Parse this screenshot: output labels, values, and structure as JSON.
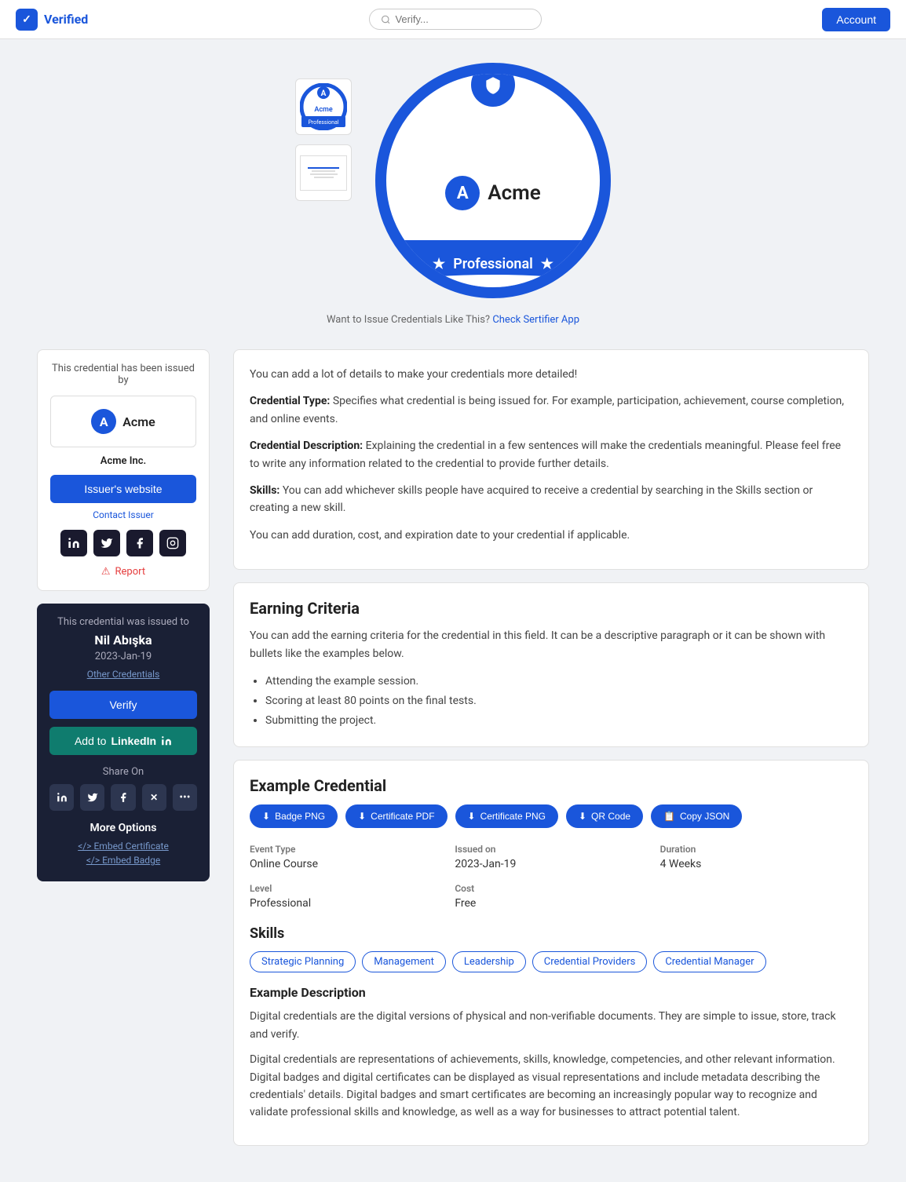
{
  "header": {
    "logo_text": "Verified",
    "search_placeholder": "Verify...",
    "account_btn": "Account"
  },
  "badge": {
    "company_letter": "A",
    "company_name": "Acme",
    "level": "Professional"
  },
  "want_to_issue": {
    "text": "Want to Issue Credentials Like This?",
    "link_text": "Check Sertifier App"
  },
  "sidebar": {
    "issued_by_title": "This credential has been issued by",
    "issuer_letter": "A",
    "issuer_name": "Acme",
    "issuer_company": "Acme Inc.",
    "issuer_website_btn": "Issuer's website",
    "contact_issuer": "Contact Issuer",
    "report_text": "Report",
    "issued_to_title": "This credential was issued to",
    "recipient_name": "Nil Abışka",
    "issue_date": "2023-Jan-19",
    "other_credentials": "Other Credentials",
    "verify_btn": "Verify",
    "linkedin_btn_text": "Add to",
    "linkedin_word": "LinkedIn",
    "share_on": "Share On",
    "more_options": "More Options",
    "embed_certificate": "</> Embed Certificate",
    "embed_badge": "</> Embed Badge"
  },
  "description": {
    "intro": "You can add a lot of details to make your credentials more detailed!",
    "credential_type_label": "Credential Type:",
    "credential_type_text": " Specifies what credential is being issued for. For example, participation, achievement, course completion, and online events.",
    "credential_desc_label": "Credential Description:",
    "credential_desc_text": " Explaining the credential in a few sentences will make the credentials meaningful. Please feel free to write any information related to the credential to provide further details.",
    "skills_label": "Skills:",
    "skills_text": " You can add whichever skills people have acquired to receive a credential by searching in the Skills section or creating a new skill.",
    "duration_text": "You can add duration, cost, and expiration date to your credential if applicable."
  },
  "earning_criteria": {
    "title": "Earning Criteria",
    "intro": "You can add the earning criteria for the credential in this field. It can be a descriptive paragraph or it can be shown with bullets like the examples below.",
    "items": [
      "Attending the example session.",
      "Scoring at least 80 points on the final tests.",
      "Submitting the project."
    ]
  },
  "example_credential": {
    "title": "Example Credential",
    "buttons": [
      {
        "label": "Badge PNG",
        "icon": "⬇"
      },
      {
        "label": "Certificate PDF",
        "icon": "⬇"
      },
      {
        "label": "Certificate PNG",
        "icon": "⬇"
      },
      {
        "label": "QR Code",
        "icon": "⬇"
      },
      {
        "label": "Copy JSON",
        "icon": "📋"
      }
    ],
    "details": {
      "event_type_label": "Event Type",
      "event_type_value": "Online Course",
      "issued_on_label": "Issued on",
      "issued_on_value": "2023-Jan-19",
      "duration_label": "Duration",
      "duration_value": "4 Weeks",
      "level_label": "Level",
      "level_value": "Professional",
      "cost_label": "Cost",
      "cost_value": "Free"
    },
    "skills_title": "Skills",
    "skills": [
      {
        "label": "Strategic Planning",
        "filled": false
      },
      {
        "label": "Management",
        "filled": false
      },
      {
        "label": "Leadership",
        "filled": false
      },
      {
        "label": "Credential Providers",
        "filled": false
      },
      {
        "label": "Credential Manager",
        "filled": false
      }
    ],
    "example_desc_title": "Example Description",
    "example_desc_1": "Digital credentials are the digital versions of physical and non-verifiable documents. They are simple to issue, store, track and verify.",
    "example_desc_2": "Digital credentials are representations of achievements, skills, knowledge, competencies, and other relevant information. Digital badges and digital certificates can be displayed as visual representations and include metadata describing the credentials' details. Digital badges and smart certificates are becoming an increasingly popular way to recognize and validate professional skills and knowledge, as well as a way for businesses to attract potential talent."
  }
}
